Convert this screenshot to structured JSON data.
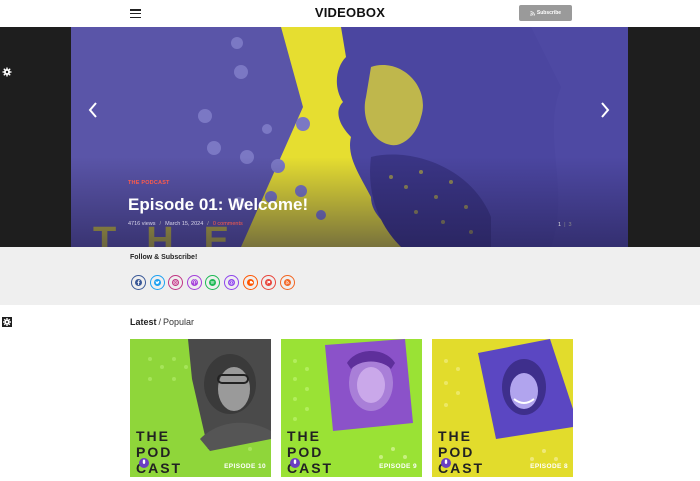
{
  "header": {
    "logo": "VIDEOBOX",
    "subscribe_label": "Subscribe",
    "menu_icon": "hamburger-menu-icon",
    "rss_icon": "rss-icon"
  },
  "hero": {
    "category": "THE PODCAST",
    "title": "Episode 01: Welcome!",
    "views": "4716 views",
    "date": "March 15, 2024",
    "comments": "0 comments",
    "pager_current": "1",
    "pager_total": "3",
    "prev_icon": "chevron-left-icon",
    "next_icon": "chevron-right-icon",
    "bg_text": "T H E",
    "colors": {
      "purple": "#5a55a8",
      "yellow": "#e8e032",
      "accent": "#ff5b4a"
    }
  },
  "settings_icon": "gear-icon",
  "follow": {
    "title": "Follow & Subscribe!",
    "networks": [
      {
        "name": "facebook",
        "icon": "facebook-icon",
        "color": "#3b5998"
      },
      {
        "name": "twitter",
        "icon": "twitter-icon",
        "color": "#1da1f2"
      },
      {
        "name": "instagram",
        "icon": "instagram-icon",
        "color": "#c13584"
      },
      {
        "name": "apple-podcasts",
        "icon": "podcast-icon",
        "color": "#a340d9"
      },
      {
        "name": "spotify",
        "icon": "spotify-icon",
        "color": "#1db954"
      },
      {
        "name": "itunes",
        "icon": "itunes-icon",
        "color": "#8e44ec"
      },
      {
        "name": "soundcloud",
        "icon": "soundcloud-icon",
        "color": "#ff5500"
      },
      {
        "name": "patreon",
        "icon": "patreon-icon",
        "color": "#e8453c"
      },
      {
        "name": "rss",
        "icon": "rss-icon",
        "color": "#f26522"
      }
    ]
  },
  "latest": {
    "tab_active": "Latest",
    "separator": "/",
    "tab_inactive": "Popular",
    "cards": [
      {
        "episode": "EPISODE 10",
        "bg": "#8fd63a",
        "photo": "#3d3d3d",
        "logo_line1": "THE",
        "logo_line2": "POD",
        "logo_line3": "CAST"
      },
      {
        "episode": "EPISODE 9",
        "bg": "#9ae235",
        "photo": "#8b52c9",
        "logo_line1": "THE",
        "logo_line2": "POD",
        "logo_line3": "CAST"
      },
      {
        "episode": "EPISODE 8",
        "bg": "#e2dc2c",
        "photo": "#5b47c2",
        "logo_line1": "THE",
        "logo_line2": "POD",
        "logo_line3": "CAST"
      }
    ]
  }
}
